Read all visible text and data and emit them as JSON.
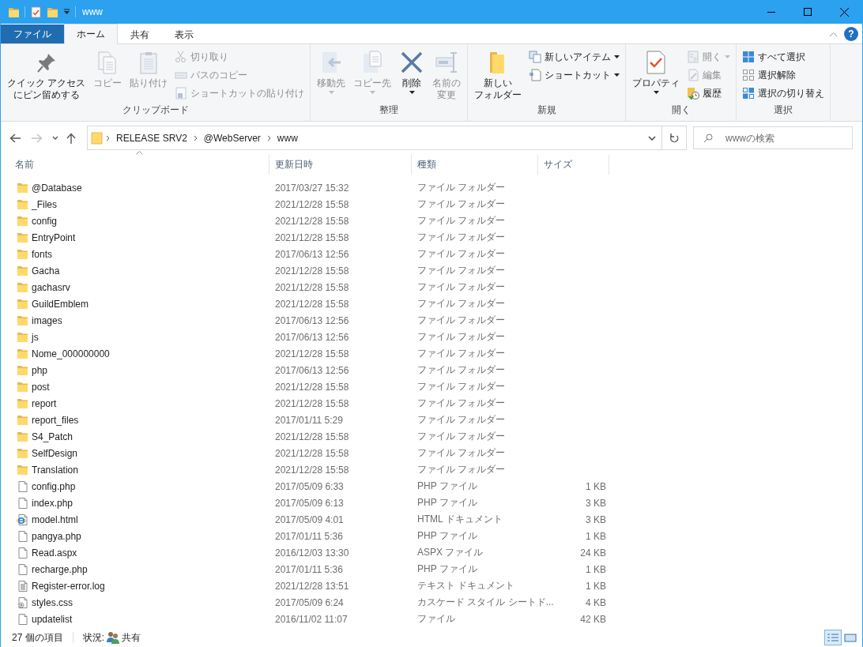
{
  "window": {
    "title": "www"
  },
  "ribbon_tabs": [
    {
      "label": "ファイル",
      "kind": "menu",
      "selected": false
    },
    {
      "label": "ホーム",
      "kind": "tab",
      "selected": true
    },
    {
      "label": "共有",
      "kind": "tab",
      "selected": false
    },
    {
      "label": "表示",
      "kind": "tab",
      "selected": false
    }
  ],
  "help_label": "?",
  "ribbon": {
    "groups": [
      {
        "label": "クリップボード",
        "items": [
          {
            "label_lines": [
              "クイック アクセス",
              "にピン留めする"
            ],
            "kind": "large",
            "disabled": false,
            "dropdown": false
          },
          {
            "label": "コピー",
            "kind": "large",
            "disabled": true,
            "dropdown": false
          },
          {
            "label": "貼り付け",
            "kind": "large",
            "disabled": true,
            "dropdown": false
          },
          {
            "label": "切り取り",
            "kind": "small",
            "disabled": true,
            "dropdown": false
          },
          {
            "label": "パスのコピー",
            "kind": "small",
            "disabled": true,
            "dropdown": false
          },
          {
            "label": "ショートカットの貼り付け",
            "kind": "small",
            "disabled": true,
            "dropdown": false
          }
        ]
      },
      {
        "label": "整理",
        "items": [
          {
            "label": "移動先",
            "kind": "large",
            "disabled": true,
            "dropdown": true
          },
          {
            "label": "コピー先",
            "kind": "large",
            "disabled": true,
            "dropdown": true
          },
          {
            "label": "削除",
            "kind": "large",
            "disabled": false,
            "dropdown": true
          },
          {
            "label_lines": [
              "名前の",
              "変更"
            ],
            "kind": "large",
            "disabled": true,
            "dropdown": false
          }
        ]
      },
      {
        "label": "新規",
        "items": [
          {
            "label_lines": [
              "新しい",
              "フォルダー"
            ],
            "kind": "large",
            "disabled": false,
            "dropdown": false
          },
          {
            "label": "新しいアイテム",
            "kind": "small",
            "disabled": false,
            "dropdown": true
          },
          {
            "label": "ショートカット",
            "kind": "small",
            "disabled": false,
            "dropdown": true
          }
        ]
      },
      {
        "label": "開く",
        "items": [
          {
            "label": "プロパティ",
            "kind": "large",
            "disabled": false,
            "dropdown": true
          },
          {
            "label": "開く",
            "kind": "small",
            "disabled": true,
            "dropdown": true
          },
          {
            "label": "編集",
            "kind": "small",
            "disabled": true,
            "dropdown": false
          },
          {
            "label": "履歴",
            "kind": "small",
            "disabled": false,
            "dropdown": false
          }
        ]
      },
      {
        "label": "選択",
        "items": [
          {
            "label": "すべて選択",
            "kind": "small",
            "disabled": false,
            "dropdown": false
          },
          {
            "label": "選択解除",
            "kind": "small",
            "disabled": false,
            "dropdown": false
          },
          {
            "label": "選択の切り替え",
            "kind": "small",
            "disabled": false,
            "dropdown": false
          }
        ]
      }
    ]
  },
  "address": {
    "back_disabled": false,
    "forward_disabled": true,
    "path": [
      "RELEASE SRV2",
      "@WebServer",
      "www"
    ],
    "search_placeholder": "wwwの検索"
  },
  "columns": [
    {
      "label": "名前",
      "sorted": true
    },
    {
      "label": "更新日時",
      "sorted": false
    },
    {
      "label": "種類",
      "sorted": false
    },
    {
      "label": "サイズ",
      "sorted": false
    }
  ],
  "files": [
    {
      "kind": "folder",
      "name": "@Database",
      "date": "2017/03/27 15:32",
      "type": "ファイル フォルダー"
    },
    {
      "kind": "folder",
      "name": "_Files",
      "date": "2021/12/28 15:58",
      "type": "ファイル フォルダー"
    },
    {
      "kind": "folder",
      "name": "config",
      "date": "2021/12/28 15:58",
      "type": "ファイル フォルダー"
    },
    {
      "kind": "folder",
      "name": "EntryPoint",
      "date": "2021/12/28 15:58",
      "type": "ファイル フォルダー"
    },
    {
      "kind": "folder",
      "name": "fonts",
      "date": "2017/06/13 12:56",
      "type": "ファイル フォルダー"
    },
    {
      "kind": "folder",
      "name": "Gacha",
      "date": "2021/12/28 15:58",
      "type": "ファイル フォルダー"
    },
    {
      "kind": "folder",
      "name": "gachasrv",
      "date": "2021/12/28 15:58",
      "type": "ファイル フォルダー"
    },
    {
      "kind": "folder",
      "name": "GuildEmblem",
      "date": "2021/12/28 15:58",
      "type": "ファイル フォルダー"
    },
    {
      "kind": "folder",
      "name": "images",
      "date": "2017/06/13 12:56",
      "type": "ファイル フォルダー"
    },
    {
      "kind": "folder",
      "name": "js",
      "date": "2017/06/13 12:56",
      "type": "ファイル フォルダー"
    },
    {
      "kind": "folder",
      "name": "Nome_000000000",
      "date": "2021/12/28 15:58",
      "type": "ファイル フォルダー"
    },
    {
      "kind": "folder",
      "name": "php",
      "date": "2017/06/13 12:56",
      "type": "ファイル フォルダー"
    },
    {
      "kind": "folder",
      "name": "post",
      "date": "2021/12/28 15:58",
      "type": "ファイル フォルダー"
    },
    {
      "kind": "folder",
      "name": "report",
      "date": "2021/12/28 15:58",
      "type": "ファイル フォルダー"
    },
    {
      "kind": "folder",
      "name": "report_files",
      "date": "2017/01/11 5:29",
      "type": "ファイル フォルダー"
    },
    {
      "kind": "folder",
      "name": "S4_Patch",
      "date": "2021/12/28 15:58",
      "type": "ファイル フォルダー"
    },
    {
      "kind": "folder",
      "name": "SelfDesign",
      "date": "2021/12/28 15:58",
      "type": "ファイル フォルダー"
    },
    {
      "kind": "folder",
      "name": "Translation",
      "date": "2021/12/28 15:58",
      "type": "ファイル フォルダー"
    },
    {
      "kind": "file",
      "name": "config.php",
      "date": "2017/05/09 6:33",
      "type": "PHP ファイル",
      "size": "1 KB"
    },
    {
      "kind": "file",
      "name": "index.php",
      "date": "2017/05/09 6:13",
      "type": "PHP ファイル",
      "size": "3 KB"
    },
    {
      "kind": "html",
      "name": "model.html",
      "date": "2017/05/09 4:01",
      "type": "HTML ドキュメント",
      "size": "3 KB"
    },
    {
      "kind": "file",
      "name": "pangya.php",
      "date": "2017/01/11 5:36",
      "type": "PHP ファイル",
      "size": "1 KB"
    },
    {
      "kind": "file",
      "name": "Read.aspx",
      "date": "2016/12/03 13:30",
      "type": "ASPX ファイル",
      "size": "24 KB"
    },
    {
      "kind": "file",
      "name": "recharge.php",
      "date": "2017/01/11 5:36",
      "type": "PHP ファイル",
      "size": "1 KB"
    },
    {
      "kind": "text",
      "name": "Register-error.log",
      "date": "2021/12/28 13:51",
      "type": "テキスト ドキュメント",
      "size": "1 KB"
    },
    {
      "kind": "css",
      "name": "styles.css",
      "date": "2017/05/09 6:24",
      "type": "カスケード スタイル シートド...",
      "size": "4 KB"
    },
    {
      "kind": "file",
      "name": "updatelist",
      "date": "2016/11/02 11:07",
      "type": "ファイル",
      "size": "42 KB"
    }
  ],
  "status_bar": {
    "item_count": "27 個の項目",
    "state_label": "状況:",
    "share_label": "共有"
  },
  "views": [
    {
      "kind": "details",
      "selected": true
    },
    {
      "kind": "large-icons",
      "selected": false
    }
  ]
}
